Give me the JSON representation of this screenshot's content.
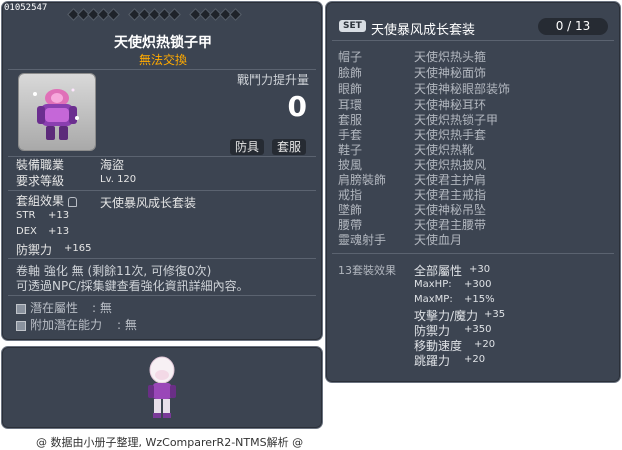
{
  "item": {
    "id": "01052547",
    "name": "天使炽热锁子甲",
    "untradeable": "無法交換",
    "power_label": "戰鬥力提升量",
    "power_value": "0",
    "tags": [
      "防具",
      "套服"
    ],
    "job_label": "裝備職業",
    "job_value": "海盜",
    "level_label": "要求等級",
    "level_value": "Lv. 120",
    "set_label": "套組效果",
    "set_value": "天使暴风成长套装",
    "stats": [
      {
        "name": "STR",
        "value": "+13"
      },
      {
        "name": "DEX",
        "value": "+13"
      },
      {
        "name": "防禦力",
        "value": "+165"
      }
    ],
    "scroll_line": "卷軸 強化 無 (剩餘11次, 可修復0次)",
    "npc_line": "可透過NPC/採集鍵查看強化資訊詳細內容。",
    "potential_label": "潛在屬性",
    "potential_value": ": 無",
    "additional_label": "附加潛在能力",
    "additional_value": ": 無"
  },
  "set": {
    "badge": "SET",
    "name": "天使暴风成长套装",
    "count": "0 / 13",
    "slots": [
      {
        "slot": "帽子",
        "item": "天使炽热头箍"
      },
      {
        "slot": "臉飾",
        "item": "天使神秘面饰"
      },
      {
        "slot": "眼飾",
        "item": "天使神秘眼部装饰"
      },
      {
        "slot": "耳環",
        "item": "天使神秘耳环"
      },
      {
        "slot": "套服",
        "item": "天使炽热锁子甲"
      },
      {
        "slot": "手套",
        "item": "天使炽热手套"
      },
      {
        "slot": "鞋子",
        "item": "天使炽热靴"
      },
      {
        "slot": "披風",
        "item": "天使炽热披风"
      },
      {
        "slot": "肩膀裝飾",
        "item": "天使君主护肩"
      },
      {
        "slot": "戒指",
        "item": "天使君主戒指"
      },
      {
        "slot": "墜飾",
        "item": "天使神秘吊坠"
      },
      {
        "slot": "腰帶",
        "item": "天使君主腰带"
      },
      {
        "slot": "靈魂射手",
        "item": "天使血月"
      }
    ],
    "effect_label": "13套裝效果",
    "effects": [
      {
        "name": "全部屬性",
        "value": "+30"
      },
      {
        "name": "MaxHP:",
        "value": "+300"
      },
      {
        "name": "MaxMP:",
        "value": "+15%"
      },
      {
        "name": "攻擊力/魔力",
        "value": "+35"
      },
      {
        "name": "防禦力",
        "value": "+350"
      },
      {
        "name": "移動速度",
        "value": "+20"
      },
      {
        "name": "跳躍力",
        "value": "+20"
      }
    ]
  },
  "footer": "@ 数据由小册子整理, WzComparerR2-NTMS解析 @"
}
